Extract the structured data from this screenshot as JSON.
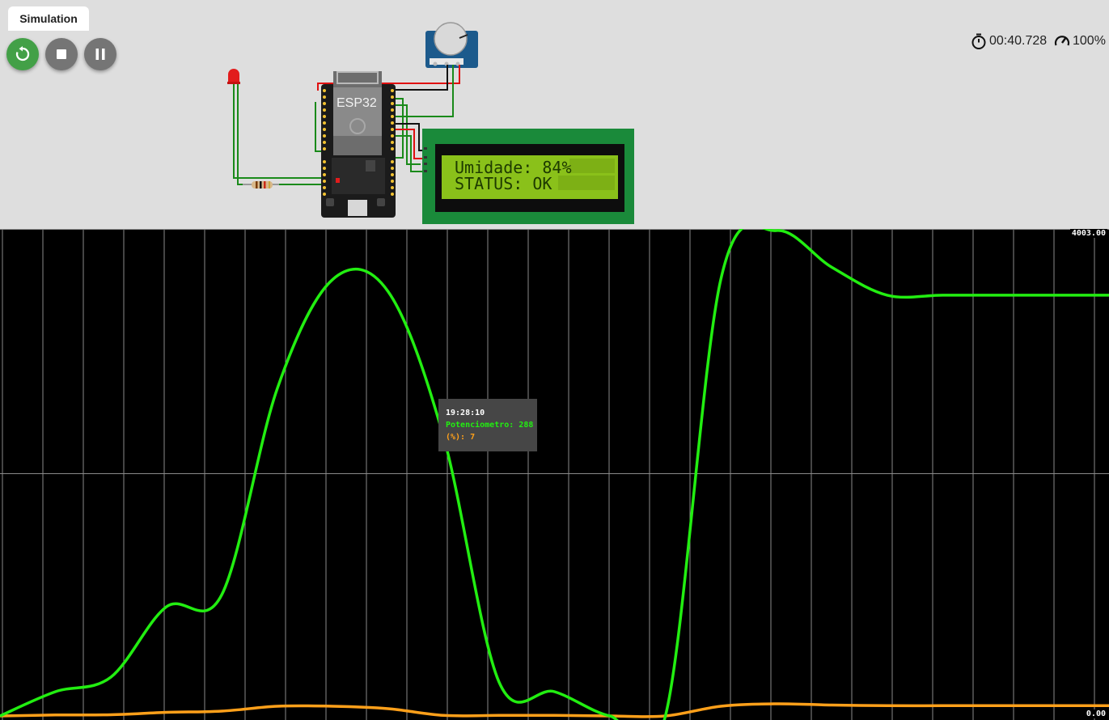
{
  "tab": {
    "label": "Simulation"
  },
  "controls": {
    "restart": "restart",
    "stop": "stop",
    "pause": "pause"
  },
  "status": {
    "timer": "00:40.728",
    "speed": "100%"
  },
  "components": {
    "mcu_label": "ESP32",
    "lcd": {
      "line1": "Umidade: 84%",
      "line2": "STATUS: OK"
    }
  },
  "plotter": {
    "y_max_label": "4003.00",
    "y_min_label": "0.00",
    "tooltip": {
      "time": "19:28:10",
      "line1": "Potenciometro: 288",
      "line2": "(%): 7"
    }
  },
  "colors": {
    "series_pot": "#22ee11",
    "series_pct": "#ffa01a",
    "restart_button": "#43a047",
    "plot_background": "#000000"
  },
  "chart_data": {
    "type": "line",
    "ylim": [
      0,
      4003
    ],
    "series": [
      {
        "name": "Potenciometro",
        "values": [
          0,
          200,
          320,
          900,
          1000,
          2700,
          3600,
          3500,
          2300,
          280,
          200,
          0,
          0,
          3600,
          4003,
          3700,
          3470,
          3470,
          3470,
          3470,
          3470
        ]
      },
      {
        "name": "(%)",
        "values": [
          0,
          8,
          10,
          30,
          40,
          80,
          80,
          60,
          5,
          5,
          5,
          0,
          0,
          80,
          100,
          90,
          85,
          85,
          85,
          85,
          85
        ]
      }
    ]
  }
}
